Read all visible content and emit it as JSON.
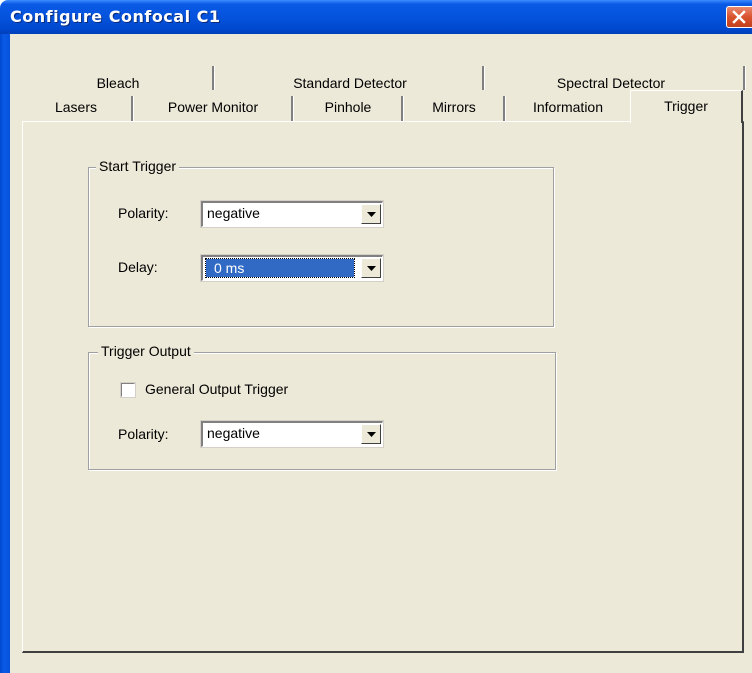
{
  "window": {
    "title": "Configure Confocal C1"
  },
  "tabs": {
    "row_top": [
      {
        "label": "Bleach"
      },
      {
        "label": "Standard Detector"
      },
      {
        "label": "Spectral Detector"
      }
    ],
    "row_bottom": [
      {
        "label": "Lasers"
      },
      {
        "label": "Power Monitor"
      },
      {
        "label": "Pinhole"
      },
      {
        "label": "Mirrors"
      },
      {
        "label": "Information"
      }
    ],
    "active": {
      "label": "Trigger"
    }
  },
  "start_trigger": {
    "title": "Start Trigger",
    "polarity_label": "Polarity:",
    "polarity_value": "negative",
    "delay_label": "Delay:",
    "delay_value": "0 ms"
  },
  "trigger_output": {
    "title": "Trigger Output",
    "general_output_label": "General Output Trigger",
    "general_output_checked": false,
    "polarity_label": "Polarity:",
    "polarity_value": "negative"
  },
  "colors": {
    "titlebar": "#0553dd",
    "face": "#ece9d8",
    "selection": "#316ac5"
  }
}
